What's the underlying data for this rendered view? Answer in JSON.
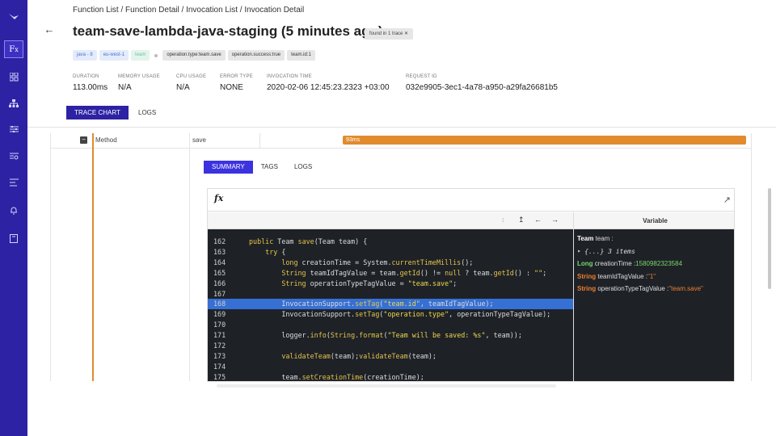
{
  "breadcrumb": "Function List / Function Detail / Invocation List / Invocation Detail",
  "title": "team-save-lambda-java-staging (5 minutes ago)",
  "found_badge": "found in 1 trace",
  "tags": {
    "runtime": "java - 8",
    "region": "eu-west-1",
    "team": "team",
    "op_type": "operation.type:team.save",
    "op_success": "operation.success:true",
    "team_id": "team.id:1"
  },
  "stats": {
    "duration_label": "DURATION",
    "duration_value": "113.00ms",
    "memory_label": "MEMORY USAGE",
    "memory_value": "N/A",
    "cpu_label": "CPU USAGE",
    "cpu_value": "N/A",
    "error_label": "ERROR TYPE",
    "error_value": "NONE",
    "time_label": "INVOCATION TIME",
    "time_value": "2020-02-06 12:45:23.2323 +03:00",
    "request_label": "REQUEST ID",
    "request_value": "032e9905-3ec1-4a78-a950-a29fa26681b5"
  },
  "main_tabs": {
    "trace": "TRACE CHART",
    "logs": "LOGS"
  },
  "span": {
    "type": "Method",
    "name": "save",
    "duration": "93ms"
  },
  "detail_tabs": {
    "summary": "SUMMARY",
    "tags": "TAGS",
    "logs": "LOGS"
  },
  "panel": {
    "fx": "fx",
    "variable_header": "Variable"
  },
  "code": {
    "highlighted_line": 168,
    "lines": [
      {
        "n": "162",
        "t": "public Team save(Team team) {"
      },
      {
        "n": "163",
        "t": "    try {"
      },
      {
        "n": "164",
        "t": "        long creationTime = System.currentTimeMillis();"
      },
      {
        "n": "165",
        "t": "        String teamIdTagValue = team.getId() != null ? team.getId() : \"\";"
      },
      {
        "n": "166",
        "t": "        String operationTypeTagValue = \"team.save\";"
      },
      {
        "n": "167",
        "t": ""
      },
      {
        "n": "168",
        "t": "        InvocationSupport.setTag(\"team.id\", teamIdTagValue);"
      },
      {
        "n": "169",
        "t": "        InvocationSupport.setTag(\"operation.type\", operationTypeTagValue);"
      },
      {
        "n": "170",
        "t": ""
      },
      {
        "n": "171",
        "t": "        logger.info(String.format(\"Team will be saved: %s\", team));"
      },
      {
        "n": "172",
        "t": ""
      },
      {
        "n": "173",
        "t": "        validateTeam(team);validateTeam(team);"
      },
      {
        "n": "174",
        "t": ""
      },
      {
        "n": "175",
        "t": "        team.setCreationTime(creationTime);"
      }
    ]
  },
  "variables": {
    "team_type": "Team",
    "team_name": "team :",
    "items": "{...} 3 items",
    "long_type": "Long",
    "long_name": "creationTime :",
    "long_value": "1580982323584",
    "s1_type": "String",
    "s1_name": "teamIdTagValue :",
    "s1_value": "\"1\"",
    "s2_type": "String",
    "s2_name": "operationTypeTagValue :",
    "s2_value": "\"team.save\""
  },
  "colors": {
    "sidebar": "#2d22a3",
    "accent": "#3b32e0",
    "span": "#e28a2e"
  }
}
